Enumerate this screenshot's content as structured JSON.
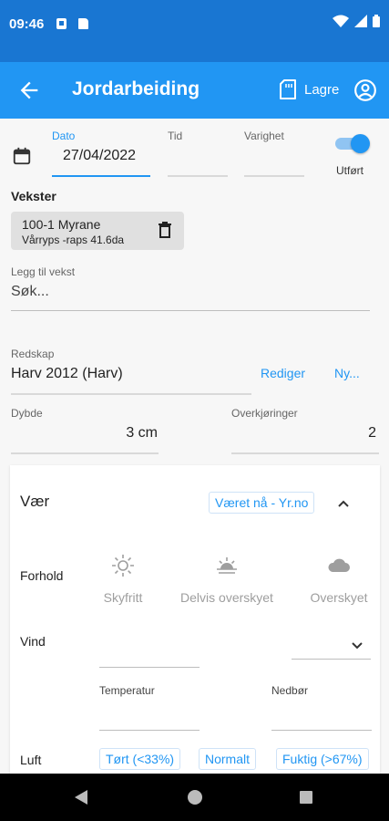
{
  "status_bar": {
    "time": "09:46"
  },
  "app_bar": {
    "title": "Jordarbeiding",
    "save_label": "Lagre"
  },
  "form": {
    "date": {
      "label": "Dato",
      "value": "27/04/2022"
    },
    "time": {
      "label": "Tid",
      "value": ""
    },
    "duration": {
      "label": "Varighet",
      "value": ""
    },
    "done": {
      "label": "Utført",
      "checked": true
    },
    "crops": {
      "heading": "Vekster",
      "items": [
        {
          "name": "100-1 Myrane",
          "detail": "Vårryps -raps  41.6da"
        }
      ]
    },
    "add_crop": {
      "label": "Legg til vekst",
      "placeholder": "Søk..."
    },
    "equipment": {
      "label": "Redskap",
      "value": "Harv 2012 (Harv)",
      "edit_label": "Rediger",
      "new_label": "Ny..."
    },
    "depth": {
      "label": "Dybde",
      "value": "3 cm"
    },
    "passes": {
      "label": "Overkjøringer",
      "value": "2"
    }
  },
  "weather": {
    "title": "Vær",
    "yr_button": "Været nå - Yr.no",
    "conditions_label": "Forhold",
    "conditions": [
      {
        "label": "Skyfritt",
        "icon": "sun-icon"
      },
      {
        "label": "Delvis overskyet",
        "icon": "partly-cloudy-icon"
      },
      {
        "label": "Overskyet",
        "icon": "cloud-icon"
      }
    ],
    "wind_label": "Vind",
    "temperature_label": "Temperatur",
    "precipitation_label": "Nedbør",
    "humidity_label": "Luft",
    "humidity_options": [
      "Tørt (<33%)",
      "Normalt",
      "Fuktig (>67%)"
    ]
  },
  "colors": {
    "primary": "#2196f3",
    "status_bar": "#1976d2",
    "card": "#ffffff"
  }
}
